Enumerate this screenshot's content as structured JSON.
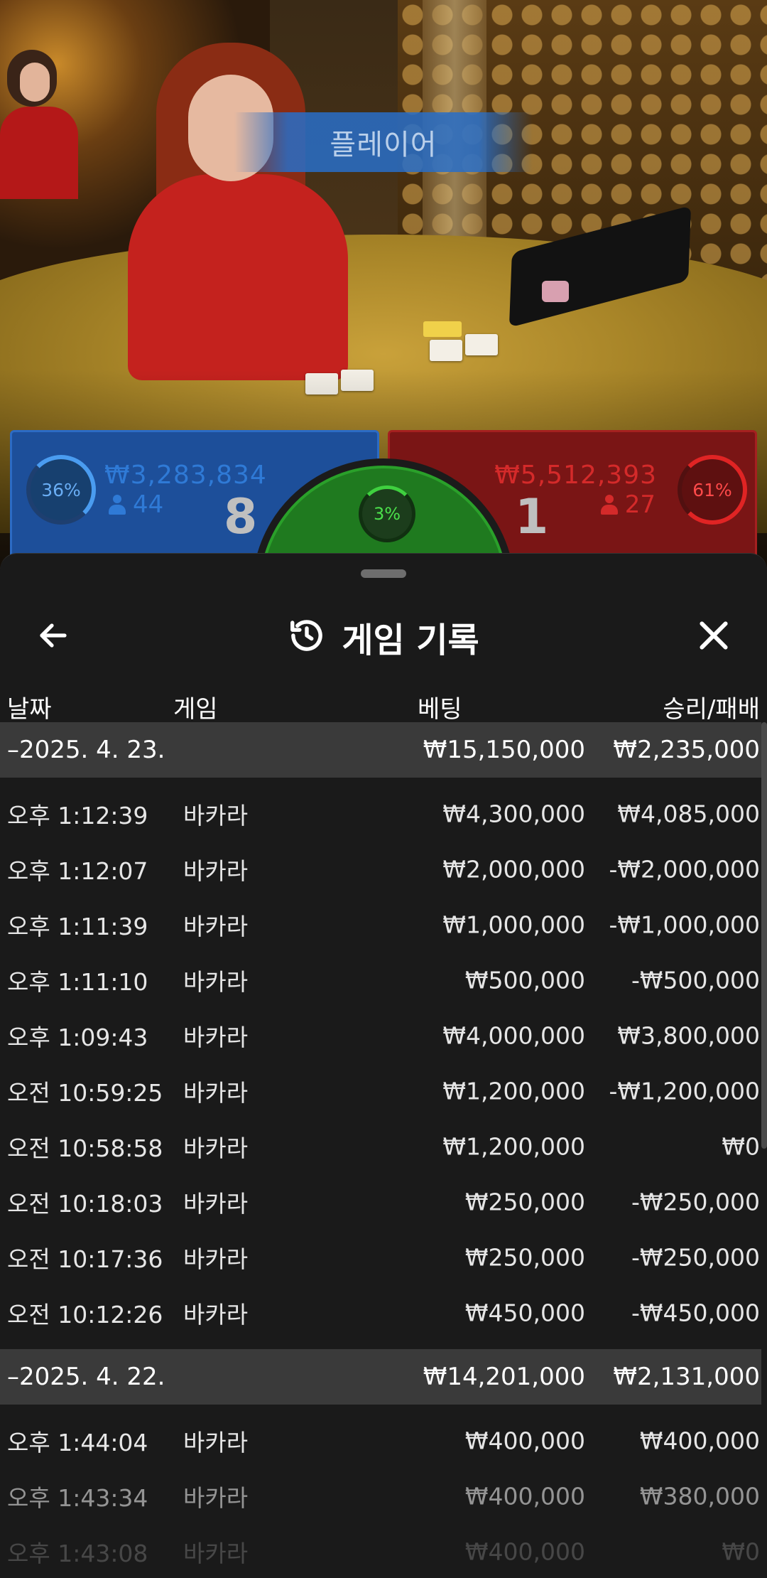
{
  "video": {
    "status_banner": "플레이어"
  },
  "bets": {
    "player": {
      "percent": "36%",
      "amount": "₩3,283,834",
      "players": "44",
      "score": "8",
      "color": "#1d4f9a"
    },
    "tie": {
      "percent": "3%",
      "color": "#1f7a1f"
    },
    "banker": {
      "percent": "61%",
      "amount": "₩5,512,393",
      "players": "27",
      "score": "1",
      "color": "#7a1515"
    }
  },
  "sheet": {
    "title": "게임 기록",
    "back_icon": "arrow-left-icon",
    "history_icon": "history-icon",
    "close_icon": "close-icon",
    "columns": {
      "date": "날짜",
      "game": "게임",
      "bet": "베팅",
      "win_loss": "승리/패배"
    },
    "groups": [
      {
        "date": "–2025. 4. 23.",
        "total_bet": "₩15,150,000",
        "total_win": "₩2,235,000",
        "rows": [
          {
            "time": "오후 1:12:39",
            "game": "바카라",
            "bet": "₩4,300,000",
            "result": "₩4,085,000"
          },
          {
            "time": "오후 1:12:07",
            "game": "바카라",
            "bet": "₩2,000,000",
            "result": "-₩2,000,000"
          },
          {
            "time": "오후 1:11:39",
            "game": "바카라",
            "bet": "₩1,000,000",
            "result": "-₩1,000,000"
          },
          {
            "time": "오후 1:11:10",
            "game": "바카라",
            "bet": "₩500,000",
            "result": "-₩500,000"
          },
          {
            "time": "오후 1:09:43",
            "game": "바카라",
            "bet": "₩4,000,000",
            "result": "₩3,800,000"
          },
          {
            "time": "오전 10:59:25",
            "game": "바카라",
            "bet": "₩1,200,000",
            "result": "-₩1,200,000"
          },
          {
            "time": "오전 10:58:58",
            "game": "바카라",
            "bet": "₩1,200,000",
            "result": "₩0"
          },
          {
            "time": "오전 10:18:03",
            "game": "바카라",
            "bet": "₩250,000",
            "result": "-₩250,000"
          },
          {
            "time": "오전 10:17:36",
            "game": "바카라",
            "bet": "₩250,000",
            "result": "-₩250,000"
          },
          {
            "time": "오전 10:12:26",
            "game": "바카라",
            "bet": "₩450,000",
            "result": "-₩450,000"
          }
        ]
      },
      {
        "date": "–2025. 4. 22.",
        "total_bet": "₩14,201,000",
        "total_win": "₩2,131,000",
        "rows": [
          {
            "time": "오후 1:44:04",
            "game": "바카라",
            "bet": "₩400,000",
            "result": "₩400,000"
          },
          {
            "time": "오후 1:43:34",
            "game": "바카라",
            "bet": "₩400,000",
            "result": "₩380,000"
          },
          {
            "time": "오후 1:43:08",
            "game": "바카라",
            "bet": "₩400,000",
            "result": "₩0"
          }
        ]
      }
    ]
  }
}
